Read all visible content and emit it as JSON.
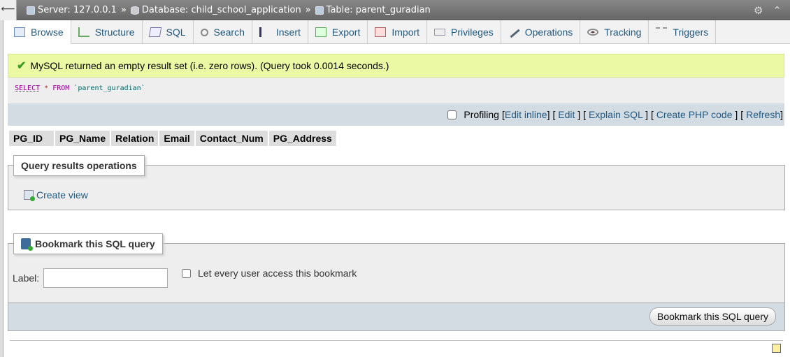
{
  "breadcrumb": {
    "server_label": "Server: 127.0.0.1",
    "sep1": "»",
    "database_label": "Database: child_school_application",
    "sep2": "»",
    "table_label": "Table: parent_guradian"
  },
  "topbar_icons": [
    "settings-icon",
    "maximize-icon"
  ],
  "tabs": [
    {
      "label": "Browse",
      "icon": "browse-icon",
      "active": true
    },
    {
      "label": "Structure",
      "icon": "structure-icon"
    },
    {
      "label": "SQL",
      "icon": "sql-icon"
    },
    {
      "label": "Search",
      "icon": "search-icon"
    },
    {
      "label": "Insert",
      "icon": "insert-icon"
    },
    {
      "label": "Export",
      "icon": "export-icon"
    },
    {
      "label": "Import",
      "icon": "import-icon"
    },
    {
      "label": "Privileges",
      "icon": "privileges-icon"
    },
    {
      "label": "Operations",
      "icon": "operations-icon"
    },
    {
      "label": "Tracking",
      "icon": "tracking-icon"
    },
    {
      "label": "Triggers",
      "icon": "triggers-icon"
    }
  ],
  "message": {
    "text": "MySQL returned an empty result set (i.e. zero rows). (Query took 0.0014 seconds.)",
    "color": "#ebf8a4"
  },
  "query": {
    "select": "SELECT",
    "star": "*",
    "from": "FROM",
    "table": "`parent_guradian`"
  },
  "profiling": {
    "label": "Profiling",
    "open1": "[",
    "edit_inline": "Edit inline",
    "close1": "]",
    "open2": "[",
    "edit": "Edit",
    "close2": "]",
    "open3": "[",
    "explain": "Explain SQL",
    "close3": "]",
    "open4": "[",
    "create_php": "Create PHP code",
    "close4": "]",
    "open5": "[",
    "refresh": "Refresh",
    "close5": "]"
  },
  "columns": [
    "PG_ID",
    "PG_Name",
    "Relation",
    "Email",
    "Contact_Num",
    "PG_Address"
  ],
  "query_ops": {
    "legend": "Query results operations",
    "create_view": "Create view"
  },
  "bookmark": {
    "legend": "Bookmark this SQL query",
    "label": "Label:",
    "label_value": "",
    "share_label": "Let every user access this bookmark",
    "button": "Bookmark this SQL query"
  }
}
